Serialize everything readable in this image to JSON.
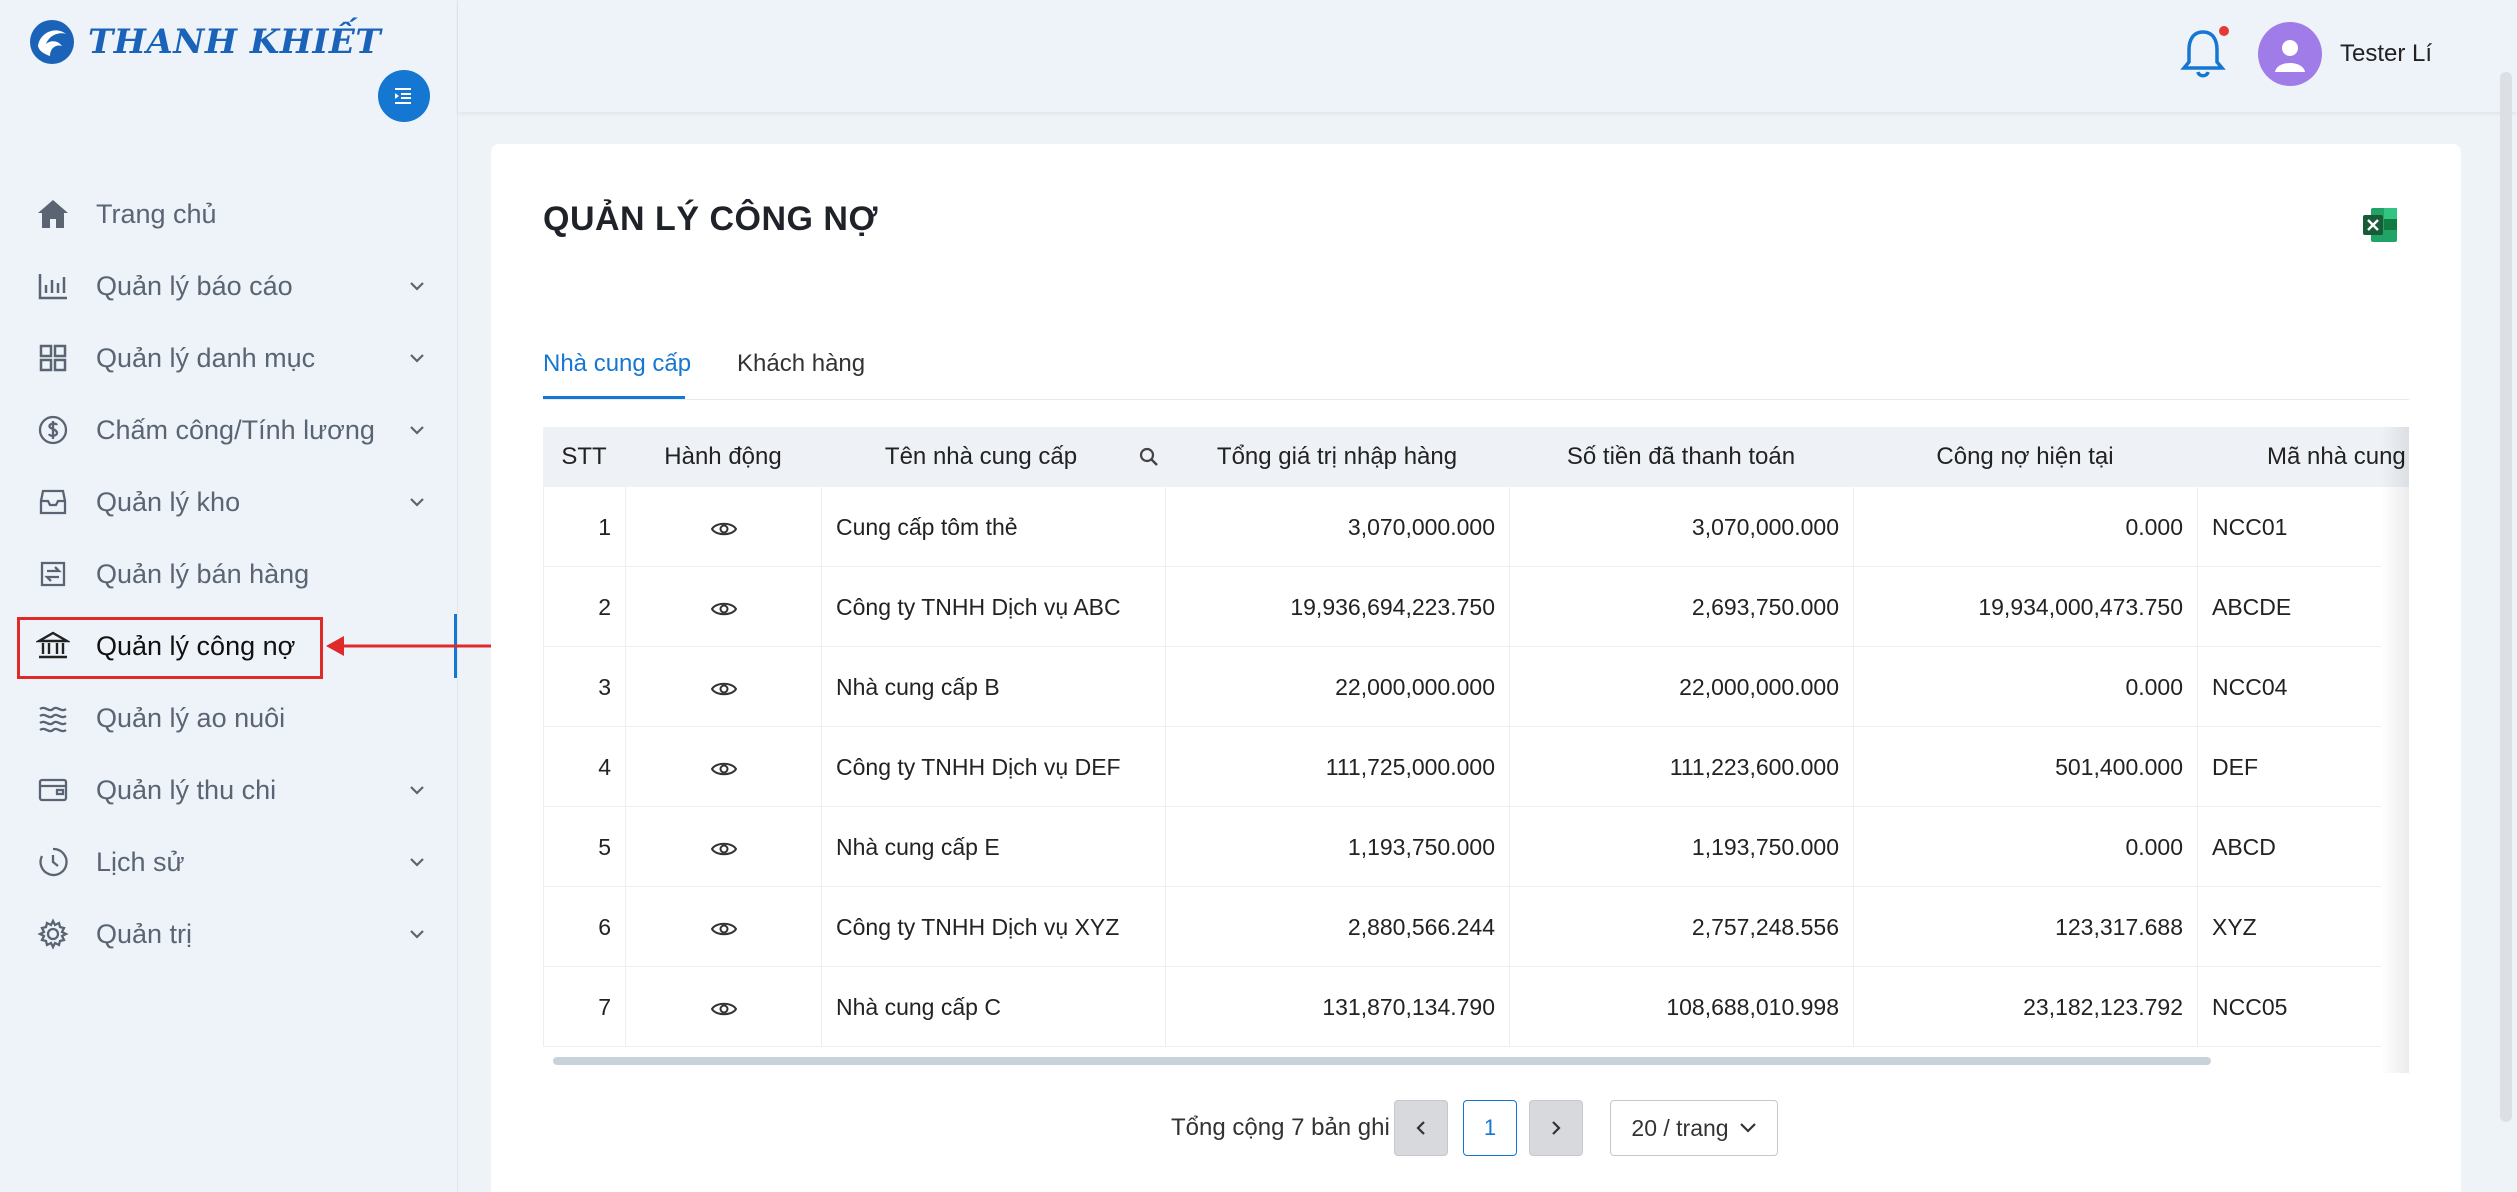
{
  "brand": {
    "name": "THANH KHIẾT"
  },
  "sidebar": {
    "items": [
      {
        "label": "Trang chủ",
        "icon": "home-icon",
        "has_submenu": false
      },
      {
        "label": "Quản lý báo cáo",
        "icon": "bar-chart-icon",
        "has_submenu": true
      },
      {
        "label": "Quản lý danh mục",
        "icon": "grid-icon",
        "has_submenu": true
      },
      {
        "label": "Chấm công/Tính lương",
        "icon": "dollar-icon",
        "has_submenu": true
      },
      {
        "label": "Quản lý kho",
        "icon": "inbox-icon",
        "has_submenu": true
      },
      {
        "label": "Quản lý bán hàng",
        "icon": "sales-icon",
        "has_submenu": false
      },
      {
        "label": "Quản lý công nợ",
        "icon": "bank-icon",
        "has_submenu": false,
        "active": true
      },
      {
        "label": "Quản lý ao nuôi",
        "icon": "waves-icon",
        "has_submenu": false
      },
      {
        "label": "Quản lý thu chi",
        "icon": "wallet-icon",
        "has_submenu": true
      },
      {
        "label": "Lịch sử",
        "icon": "clock-icon",
        "has_submenu": true
      },
      {
        "label": "Quản trị",
        "icon": "gear-icon",
        "has_submenu": true
      }
    ]
  },
  "header": {
    "username": "Tester Lí",
    "notification_dot": true
  },
  "main": {
    "title": "QUẢN LÝ CÔNG NỢ",
    "tabs": [
      {
        "label": "Nhà cung cấp",
        "active": true
      },
      {
        "label": "Khách hàng",
        "active": false
      }
    ],
    "table": {
      "columns": [
        "STT",
        "Hành động",
        "Tên nhà cung cấp",
        "Tổng giá trị nhập hàng",
        "Số tiền đã thanh toán",
        "Công nợ hiện tại",
        "Mã nhà cung"
      ],
      "rows": [
        {
          "stt": "1",
          "name": "Cung cấp tôm thẻ",
          "total": "3,070,000.000",
          "paid": "3,070,000.000",
          "debt": "0.000",
          "code": "NCC01"
        },
        {
          "stt": "2",
          "name": "Công ty TNHH Dịch vụ ABC",
          "total": "19,936,694,223.750",
          "paid": "2,693,750.000",
          "debt": "19,934,000,473.750",
          "code": "ABCDE"
        },
        {
          "stt": "3",
          "name": "Nhà cung cấp B",
          "total": "22,000,000.000",
          "paid": "22,000,000.000",
          "debt": "0.000",
          "code": "NCC04"
        },
        {
          "stt": "4",
          "name": "Công ty TNHH Dịch vụ DEF",
          "total": "111,725,000.000",
          "paid": "111,223,600.000",
          "debt": "501,400.000",
          "code": "DEF"
        },
        {
          "stt": "5",
          "name": "Nhà cung cấp E",
          "total": "1,193,750.000",
          "paid": "1,193,750.000",
          "debt": "0.000",
          "code": "ABCD"
        },
        {
          "stt": "6",
          "name": "Công ty TNHH Dịch vụ XYZ",
          "total": "2,880,566.244",
          "paid": "2,757,248.556",
          "debt": "123,317.688",
          "code": "XYZ"
        },
        {
          "stt": "7",
          "name": "Nhà cung cấp C",
          "total": "131,870,134.790",
          "paid": "108,688,010.998",
          "debt": "23,182,123.792",
          "code": "NCC05"
        }
      ]
    },
    "pagination": {
      "total_text": "Tổng cộng 7 bản ghi",
      "current_page": "1",
      "page_size": "20 / trang"
    }
  },
  "colors": {
    "accent": "#1677d2",
    "annotation": "#e02a2a",
    "avatar": "#a07ce8"
  }
}
